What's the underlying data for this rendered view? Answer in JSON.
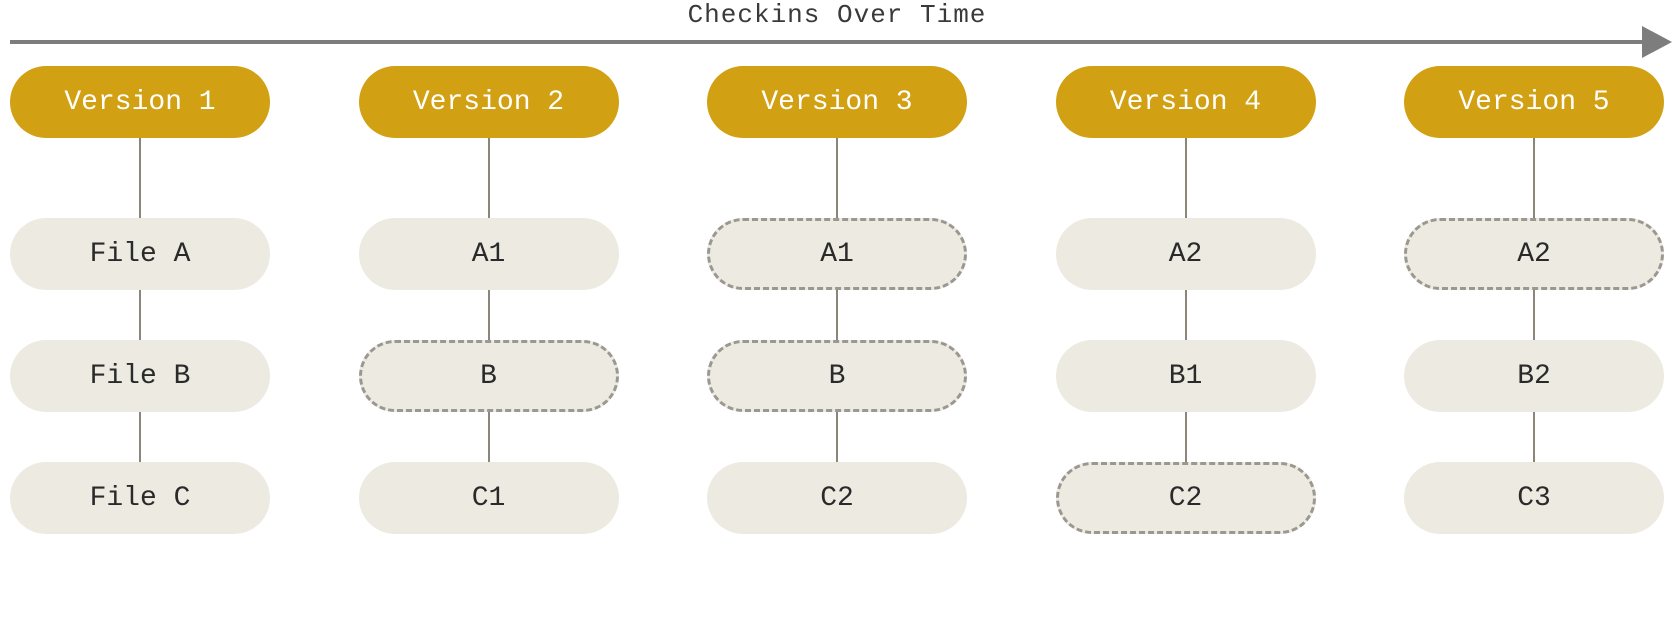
{
  "title": "Checkins Over Time",
  "columns": [
    {
      "version": "Version 1",
      "files": [
        {
          "label": "File A",
          "dashed": false
        },
        {
          "label": "File B",
          "dashed": false
        },
        {
          "label": "File C",
          "dashed": false
        }
      ]
    },
    {
      "version": "Version 2",
      "files": [
        {
          "label": "A1",
          "dashed": false
        },
        {
          "label": "B",
          "dashed": true
        },
        {
          "label": "C1",
          "dashed": false
        }
      ]
    },
    {
      "version": "Version 3",
      "files": [
        {
          "label": "A1",
          "dashed": true
        },
        {
          "label": "B",
          "dashed": true
        },
        {
          "label": "C2",
          "dashed": false
        }
      ]
    },
    {
      "version": "Version 4",
      "files": [
        {
          "label": "A2",
          "dashed": false
        },
        {
          "label": "B1",
          "dashed": false
        },
        {
          "label": "C2",
          "dashed": true
        }
      ]
    },
    {
      "version": "Version 5",
      "files": [
        {
          "label": "A2",
          "dashed": true
        },
        {
          "label": "B2",
          "dashed": false
        },
        {
          "label": "C3",
          "dashed": false
        }
      ]
    }
  ]
}
